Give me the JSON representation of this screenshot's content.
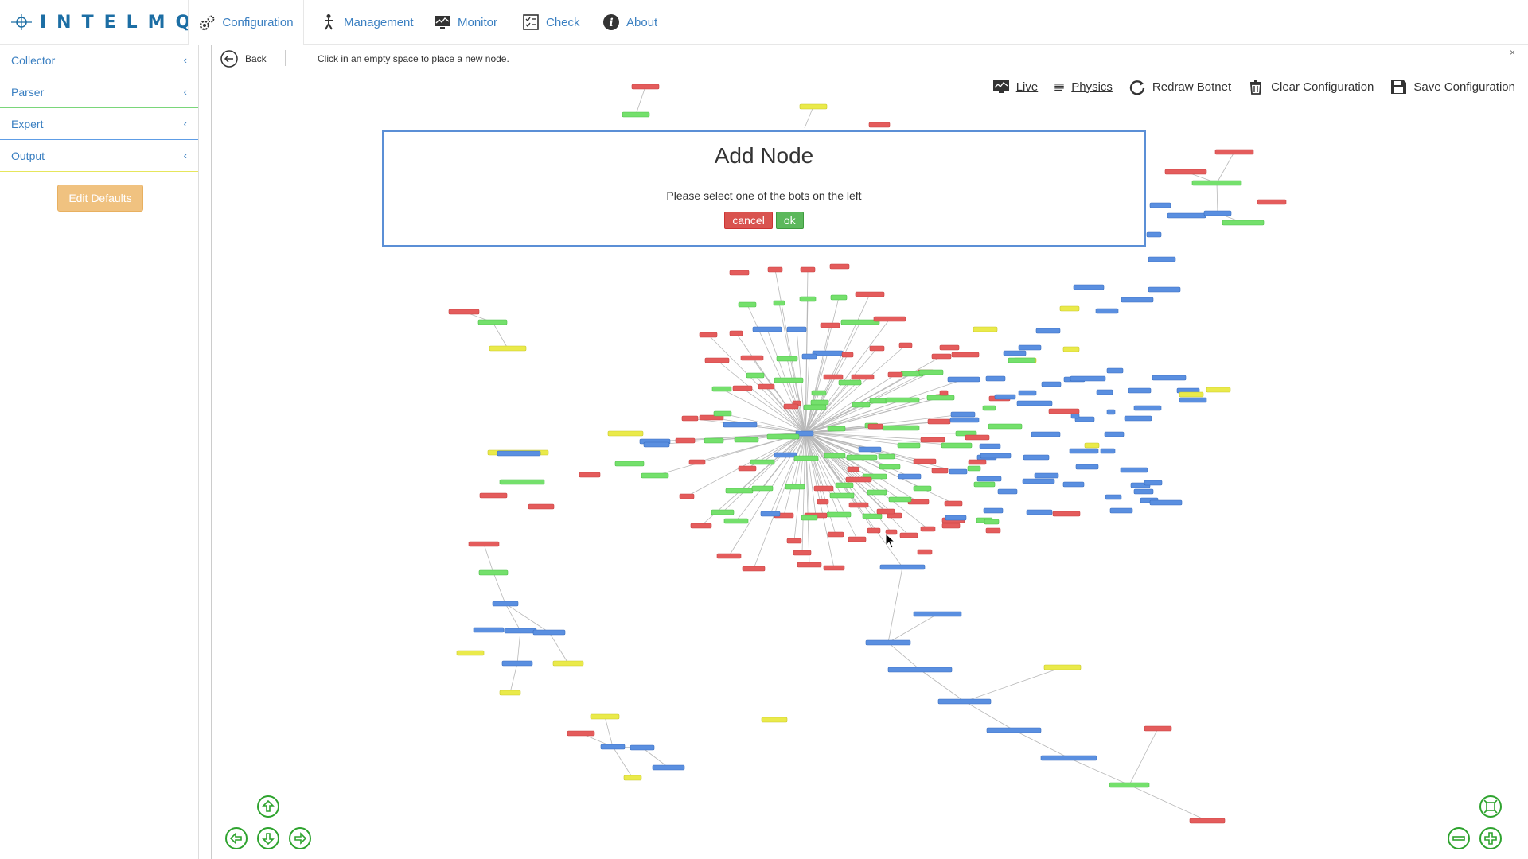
{
  "brand": {
    "name": "INTELMQ"
  },
  "nav": {
    "tabs": [
      {
        "label": "Configuration",
        "icon": "gears-icon",
        "active": true
      },
      {
        "label": "Management",
        "icon": "person-icon",
        "active": false
      },
      {
        "label": "Monitor",
        "icon": "monitor-icon",
        "active": false
      },
      {
        "label": "Check",
        "icon": "checklist-icon",
        "active": false
      },
      {
        "label": "About",
        "icon": "info-icon",
        "active": false
      }
    ]
  },
  "sidebar": {
    "items": [
      {
        "label": "Collector",
        "color": "#e86060"
      },
      {
        "label": "Parser",
        "color": "#7ad67a"
      },
      {
        "label": "Expert",
        "color": "#5e9de6"
      },
      {
        "label": "Output",
        "color": "#e6e65c"
      }
    ],
    "edit_defaults": "Edit Defaults"
  },
  "subbar": {
    "back": "Back",
    "hint": "Click in an empty space to place a new node.",
    "close": "×"
  },
  "toolbar": {
    "live": "Live",
    "physics": "Physics",
    "redraw": "Redraw Botnet",
    "clear": "Clear Configuration",
    "save": "Save Configuration"
  },
  "modal": {
    "title": "Add Node",
    "message": "Please select one of the bots on the left",
    "cancel": "cancel",
    "ok": "ok"
  },
  "colors": {
    "collector": "#e45c5c",
    "parser": "#74e06c",
    "expert": "#5a8fe0",
    "output": "#eaea4a",
    "accent": "#3a7fc1",
    "nav_green": "#2ea32e"
  }
}
